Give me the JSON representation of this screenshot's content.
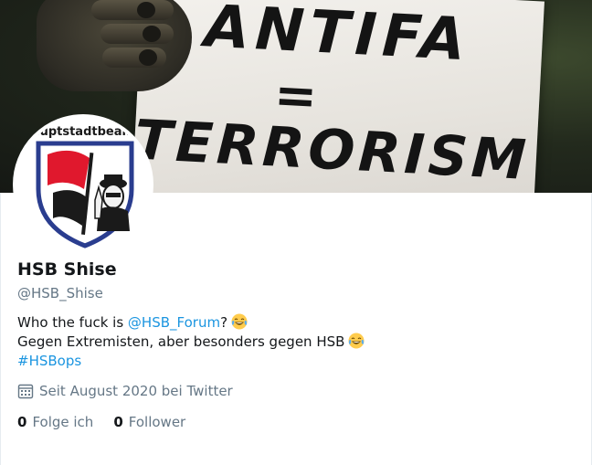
{
  "banner": {
    "sign_line1": "ANTIFA",
    "sign_line2": "=",
    "sign_line3": "TERRORISM"
  },
  "avatar": {
    "label": "Hauptstadtbeamte"
  },
  "profile": {
    "name": "HSB Shise",
    "handle": "@HSB_Shise"
  },
  "bio": {
    "line1_prefix": "Who the fuck is ",
    "line1_mention": "@HSB_Forum",
    "line1_suffix": "?",
    "line2_text": "Gegen Extremisten, aber besonders gegen HSB",
    "line3_hashtag": "#HSBops",
    "emoji_icon": "face-with-tears-of-joy-icon"
  },
  "joined": {
    "icon": "calendar-icon",
    "text": "Seit August 2020 bei Twitter"
  },
  "stats": {
    "following_count": "0",
    "following_label": "Folge ich",
    "followers_count": "0",
    "followers_label": "Follower"
  },
  "colors": {
    "link": "#1b95e0",
    "muted": "#657786",
    "text": "#14171a"
  }
}
